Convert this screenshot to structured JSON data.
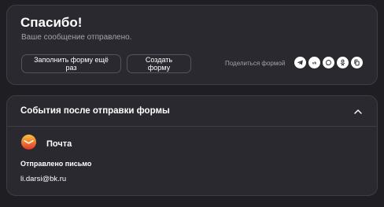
{
  "success": {
    "title": "Спасибо!",
    "subtitle": "Ваше сообщение отправлено.",
    "refill_button": "Заполнить форму ещё раз",
    "create_button": "Создать форму",
    "share_label": "Поделиться формой",
    "share_icons": [
      "telegram-icon",
      "vk-icon",
      "whatsapp-icon",
      "odnoklassniki-icon",
      "copy-icon"
    ]
  },
  "events": {
    "title": "События после отправки формы",
    "integration": {
      "name": "Почта",
      "icon": "yandex-mail-icon",
      "status": "Отправлено письмо",
      "email": "li.darsi@bk.ru"
    }
  },
  "colors": {
    "background": "#1f1e23",
    "card": "#2a2930",
    "border": "#3e3d45",
    "muted_text": "#a4a3ab",
    "mail_logo_top": "#f7c43b",
    "mail_logo_bottom": "#e4362c"
  }
}
